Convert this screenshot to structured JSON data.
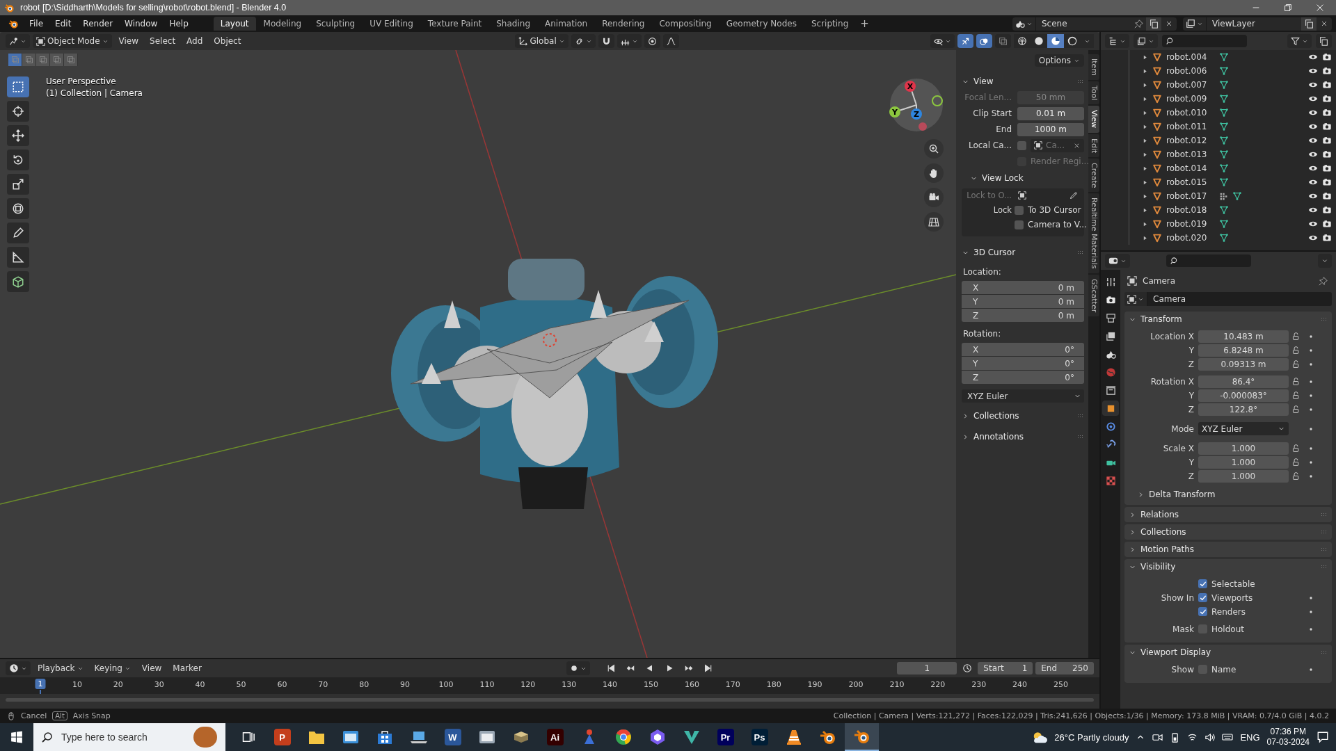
{
  "title_bar": {
    "title": "robot [D:\\Siddharth\\Models for selling\\robot\\robot.blend] - Blender 4.0"
  },
  "menu": [
    "File",
    "Edit",
    "Render",
    "Window",
    "Help"
  ],
  "workspaces": [
    {
      "label": "Layout",
      "selected": true
    },
    {
      "label": "Modeling",
      "selected": false
    },
    {
      "label": "Sculpting",
      "selected": false
    },
    {
      "label": "UV Editing",
      "selected": false
    },
    {
      "label": "Texture Paint",
      "selected": false
    },
    {
      "label": "Shading",
      "selected": false
    },
    {
      "label": "Animation",
      "selected": false
    },
    {
      "label": "Rendering",
      "selected": false
    },
    {
      "label": "Compositing",
      "selected": false
    },
    {
      "label": "Geometry Nodes",
      "selected": false
    },
    {
      "label": "Scripting",
      "selected": false
    }
  ],
  "add_workspace": "+",
  "scene": {
    "value": "Scene"
  },
  "view_layer": {
    "value": "ViewLayer"
  },
  "viewport": {
    "mode": "Object Mode",
    "menus": [
      "View",
      "Select",
      "Add",
      "Object"
    ],
    "orientation": "Global",
    "shading": [
      {
        "selected": false
      },
      {
        "selected": false
      },
      {
        "selected": true
      },
      {
        "selected": false
      }
    ],
    "select_modes": [
      {
        "selected": true
      },
      {
        "selected": false
      },
      {
        "selected": false
      },
      {
        "selected": false
      },
      {
        "selected": false
      }
    ],
    "overlay_text": [
      "User Perspective",
      "(1) Collection | Camera"
    ],
    "tools": [
      {
        "kind": "select",
        "selected": true
      },
      {
        "kind": "cursor",
        "selected": false
      },
      {
        "kind": "move",
        "selected": false
      },
      {
        "kind": "rotate",
        "selected": false
      },
      {
        "kind": "scale",
        "selected": false
      },
      {
        "kind": "transform",
        "selected": false
      },
      {
        "kind": "annotate",
        "selected": false
      },
      {
        "kind": "measure",
        "selected": false
      },
      {
        "kind": "add-cube",
        "selected": false
      }
    ],
    "gizmo_axes": [
      "X",
      "Y",
      "Z"
    ],
    "options": "Options"
  },
  "sidebar": {
    "tabs": [
      {
        "label": "Item",
        "selected": false
      },
      {
        "label": "Tool",
        "selected": false
      },
      {
        "label": "View",
        "selected": true
      },
      {
        "label": "Edit",
        "selected": false
      },
      {
        "label": "Create",
        "selected": false
      },
      {
        "label": "Realtime Materials",
        "selected": false
      },
      {
        "label": "GScatter",
        "selected": false
      }
    ],
    "panels": [
      {
        "title": "View",
        "expanded": true,
        "rows": [
          {
            "kind": "field",
            "label": "Focal Len...",
            "value": "50 mm",
            "disabled": true
          },
          {
            "kind": "field",
            "label": "Clip Start",
            "value": "0.01 m",
            "disabled": false
          },
          {
            "kind": "field",
            "label": "End",
            "value": "1000 m",
            "disabled": false
          },
          {
            "kind": "object",
            "label": "Local Ca...",
            "value": "Ca...",
            "checked": false
          },
          {
            "kind": "checkbox",
            "text": "Render Regi...",
            "checked": false,
            "disabled": true
          }
        ],
        "subpanel": {
          "title": "View Lock",
          "expanded": true,
          "rows": [
            {
              "kind": "picker",
              "label": "Lock to O...",
              "disabled": true
            },
            {
              "kind": "checkbox",
              "label": "Lock",
              "text": "To 3D Cursor",
              "checked": false,
              "disabled": false
            },
            {
              "kind": "checkbox",
              "text": "Camera to V...",
              "checked": false,
              "disabled": false
            }
          ]
        }
      },
      {
        "title": "3D Cursor",
        "expanded": true,
        "rows": [
          {
            "kind": "caption",
            "text": "Location:"
          },
          {
            "kind": "vector",
            "items": [
              {
                "axis": "X",
                "value": "0 m"
              },
              {
                "axis": "Y",
                "value": "0 m"
              },
              {
                "axis": "Z",
                "value": "0 m"
              }
            ]
          },
          {
            "kind": "caption",
            "text": "Rotation:"
          },
          {
            "kind": "vector",
            "items": [
              {
                "axis": "X",
                "value": "0°"
              },
              {
                "axis": "Y",
                "value": "0°"
              },
              {
                "axis": "Z",
                "value": "0°"
              }
            ]
          },
          {
            "kind": "dropdown",
            "value": "XYZ Euler"
          }
        ]
      },
      {
        "title": "Collections",
        "expanded": false
      },
      {
        "title": "Annotations",
        "expanded": false
      }
    ]
  },
  "outliner": {
    "items": [
      {
        "name": "robot.004",
        "modifier": false
      },
      {
        "name": "robot.006",
        "modifier": false
      },
      {
        "name": "robot.007",
        "modifier": false
      },
      {
        "name": "robot.009",
        "modifier": false
      },
      {
        "name": "robot.010",
        "modifier": false
      },
      {
        "name": "robot.011",
        "modifier": false
      },
      {
        "name": "robot.012",
        "modifier": false
      },
      {
        "name": "robot.013",
        "modifier": false
      },
      {
        "name": "robot.014",
        "modifier": false
      },
      {
        "name": "robot.015",
        "modifier": false
      },
      {
        "name": "robot.017",
        "modifier": true
      },
      {
        "name": "robot.018",
        "modifier": false
      },
      {
        "name": "robot.019",
        "modifier": false
      },
      {
        "name": "robot.020",
        "modifier": false
      }
    ]
  },
  "properties": {
    "tabs": [
      {
        "kind": "tool",
        "selected": false
      },
      {
        "kind": "render",
        "selected": false
      },
      {
        "kind": "output",
        "selected": false
      },
      {
        "kind": "view-layer",
        "selected": false
      },
      {
        "kind": "scene",
        "selected": false
      },
      {
        "kind": "world",
        "selected": false
      },
      {
        "kind": "collection",
        "selected": false
      },
      {
        "kind": "object",
        "selected": true
      },
      {
        "kind": "physics",
        "selected": false
      },
      {
        "kind": "constraints",
        "selected": false
      },
      {
        "kind": "data",
        "selected": false
      },
      {
        "kind": "texture",
        "selected": false
      }
    ],
    "object_name": "Camera",
    "datablock": "Camera",
    "panels": [
      {
        "title": "Transform",
        "expanded": true,
        "groups": [
          [
            {
              "kind": "field",
              "label": "Location X",
              "value": "10.483 m",
              "animatable": true
            },
            {
              "kind": "field",
              "label": "Y",
              "value": "6.8248 m",
              "animatable": true
            },
            {
              "kind": "field",
              "label": "Z",
              "value": "0.09313 m",
              "animatable": true
            }
          ],
          [
            {
              "kind": "field",
              "label": "Rotation X",
              "value": "86.4°",
              "animatable": true
            },
            {
              "kind": "field",
              "label": "Y",
              "value": "-0.000083°",
              "animatable": true
            },
            {
              "kind": "field",
              "label": "Z",
              "value": "122.8°",
              "animatable": true
            }
          ],
          [
            {
              "kind": "dropdown",
              "label": "Mode",
              "value": "XYZ Euler",
              "animatable": true
            }
          ],
          [
            {
              "kind": "field",
              "label": "Scale X",
              "value": "1.000",
              "animatable": true
            },
            {
              "kind": "field",
              "label": "Y",
              "value": "1.000",
              "animatable": true
            },
            {
              "kind": "field",
              "label": "Z",
              "value": "1.000",
              "animatable": true
            }
          ]
        ],
        "subpanel": {
          "title": "Delta Transform",
          "expanded": false
        }
      },
      {
        "title": "Relations",
        "expanded": false
      },
      {
        "title": "Collections",
        "expanded": false
      },
      {
        "title": "Motion Paths",
        "expanded": false
      },
      {
        "title": "Visibility",
        "expanded": true,
        "groups": [
          [
            {
              "kind": "checkbox",
              "text": "Selectable",
              "checked": true,
              "animatable": false
            },
            {
              "kind": "checkbox",
              "label": "Show In",
              "text": "Viewports",
              "checked": true,
              "animatable": true
            },
            {
              "kind": "checkbox",
              "text": "Renders",
              "checked": true,
              "animatable": true
            }
          ],
          [
            {
              "kind": "checkbox",
              "label": "Mask",
              "text": "Holdout",
              "checked": false,
              "animatable": true
            }
          ]
        ]
      },
      {
        "title": "Viewport Display",
        "expanded": true,
        "groups": [
          [
            {
              "kind": "checkbox",
              "label": "Show",
              "text": "Name",
              "checked": false,
              "animatable": true
            }
          ]
        ]
      }
    ]
  },
  "timeline": {
    "menus": [
      "Playback",
      "Keying",
      "View",
      "Marker"
    ],
    "current_frame": "1",
    "start_label": "Start",
    "start": "1",
    "end_label": "End",
    "end": "250",
    "playhead": "1",
    "ticks": [
      "10",
      "20",
      "30",
      "40",
      "50",
      "60",
      "70",
      "80",
      "90",
      "100",
      "110",
      "120",
      "130",
      "140",
      "150",
      "160",
      "170",
      "180",
      "190",
      "200",
      "210",
      "220",
      "230",
      "240",
      "250"
    ]
  },
  "status_bar": {
    "hints": [
      {
        "kind": "mouse",
        "text": "Cancel"
      },
      {
        "kind": "key",
        "key": "Alt",
        "text": "Axis Snap"
      }
    ],
    "stats": "Collection | Camera | Verts:121,272 | Faces:122,029 | Tris:241,626 | Objects:1/36 | Memory: 173.8 MiB | VRAM: 0.7/4.0 GiB | 4.0.2"
  },
  "taskbar": {
    "search_placeholder": "Type here to search",
    "apps": [
      {
        "kind": "task-view",
        "selected": false
      },
      {
        "kind": "letter",
        "label": "P",
        "color": "#c43e1c",
        "selected": false
      },
      {
        "kind": "folder",
        "color": "#f4c542",
        "selected": false
      },
      {
        "kind": "window",
        "color": "#3a8fd8",
        "selected": false
      },
      {
        "kind": "store",
        "color": "#2b7bd6",
        "selected": false
      },
      {
        "kind": "laptop",
        "color": "#5aa9e6",
        "selected": false
      },
      {
        "kind": "letter",
        "label": "W",
        "color": "#2b579a",
        "selected": false
      },
      {
        "kind": "window",
        "color": "#9aa7b4",
        "selected": false
      },
      {
        "kind": "book",
        "color": "#d9c48a",
        "selected": false
      },
      {
        "kind": "letter",
        "label": "Ai",
        "color": "#330000",
        "selected": false
      },
      {
        "kind": "figure",
        "color": "#e0452e",
        "selected": false
      },
      {
        "kind": "chrome",
        "color": "#34a853",
        "selected": false
      },
      {
        "kind": "hexagon",
        "color": "#7b5cf0",
        "selected": false
      },
      {
        "kind": "vee",
        "color": "#3fb6a8",
        "selected": false
      },
      {
        "kind": "letter",
        "label": "Pr",
        "color": "#00005b",
        "selected": false
      },
      {
        "kind": "letter",
        "label": "Ps",
        "color": "#001e36",
        "selected": false
      },
      {
        "kind": "cone",
        "color": "#f08a24",
        "selected": false
      },
      {
        "kind": "blender",
        "color": "#e87d0d",
        "selected": false
      },
      {
        "kind": "blender",
        "color": "#e87d0d",
        "selected": true
      }
    ],
    "weather": "26°C Partly cloudy",
    "language": "ENG",
    "time": "07:36 PM",
    "date": "07-03-2024"
  }
}
